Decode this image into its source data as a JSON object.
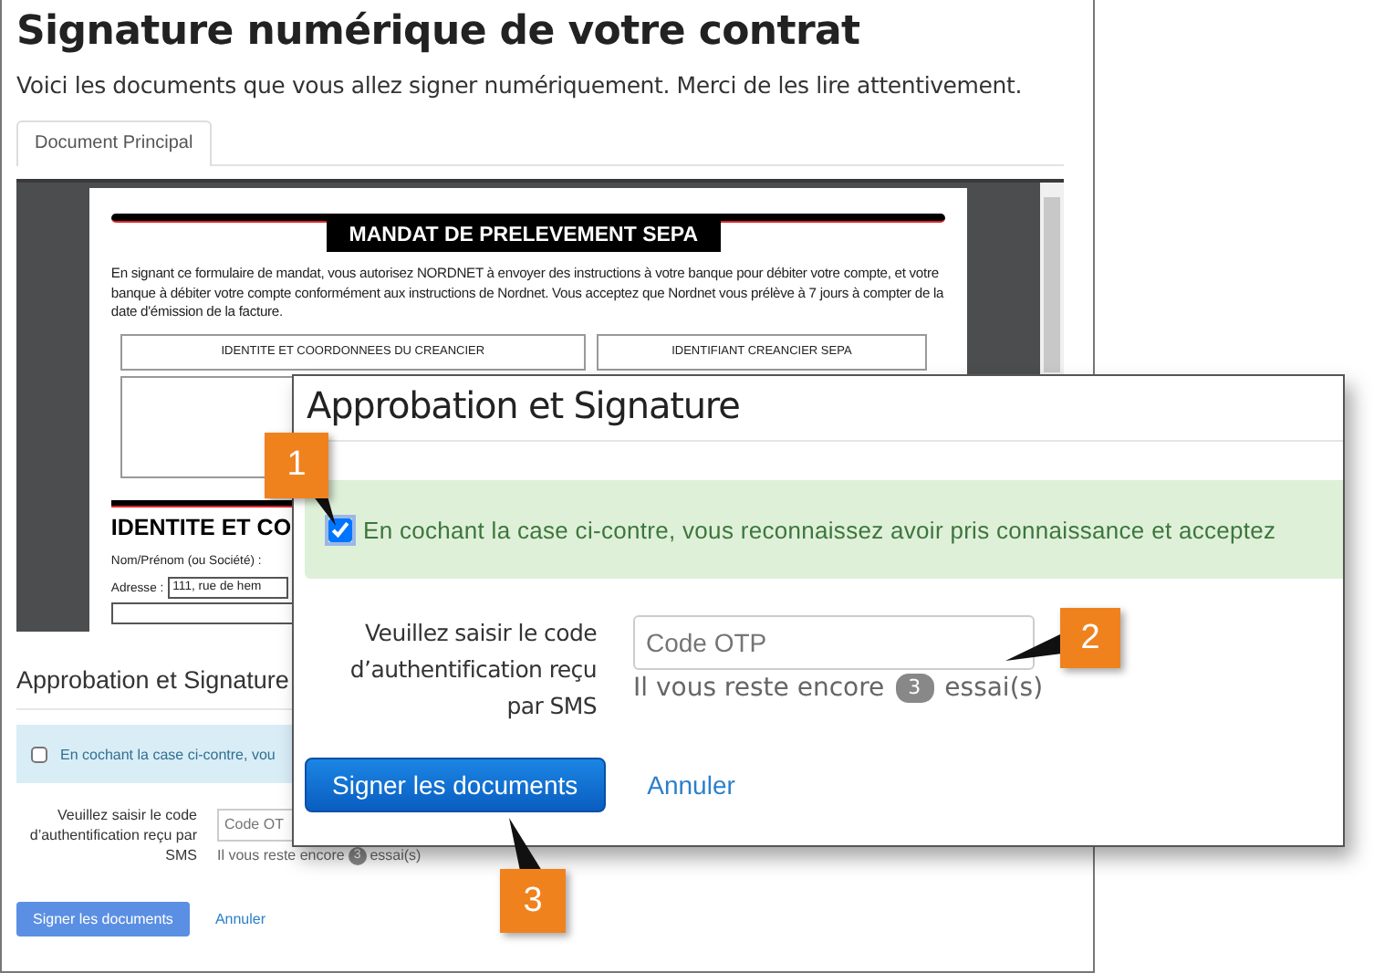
{
  "page": {
    "title": "Signature numérique de votre contrat",
    "intro": "Voici les documents que vous allez signer numériquement. Merci de les lire attentivement."
  },
  "tabs": [
    {
      "label": "Document Principal",
      "selected": true
    }
  ],
  "document": {
    "heading": "MANDAT DE PRELEVEMENT SEPA",
    "paragraph": "En signant ce formulaire de mandat, vous autorisez NORDNET à envoyer des instructions à votre banque pour débiter votre compte, et votre banque à débiter votre compte conformément aux instructions de Nordnet. Vous acceptez que Nordnet vous prélève à 7 jours à compter de la date d'émission de la facture.",
    "boxes": [
      "IDENTITE ET COORDONNEES DU CREANCIER",
      "IDENTIFIANT CREANCIER SEPA"
    ],
    "section_heading": "IDENTITE ET CO",
    "fields": [
      {
        "label": "Nom/Prénom (ou Société) :"
      },
      {
        "label": "Adresse :",
        "value": "111, rue de hem"
      }
    ]
  },
  "approval_section": {
    "title": "Approbation et Signature",
    "consent": {
      "checked": false,
      "text": "En cochant la case ci-contre, vou"
    },
    "code_label": "Veuillez saisir le code d’authentification reçu par SMS",
    "code_placeholder": "Code OT",
    "attempts_before": "Il vous reste encore",
    "attempts": "3",
    "attempts_after": "essai(s)",
    "sign_button": "Signer les documents",
    "cancel_link": "Annuler"
  },
  "dialog": {
    "title": "Approbation et Signature",
    "consent": {
      "checked": true,
      "text": "En cochant la case ci-contre, vous reconnaissez avoir pris connaissance et acceptez"
    },
    "code_label": "Veuillez saisir le code d’authentification reçu par SMS",
    "code_placeholder": "Code OTP",
    "attempts_before": "Il vous reste encore",
    "attempts": "3",
    "attempts_after": "essai(s)",
    "sign_button": "Signer les documents",
    "cancel_link": "Annuler"
  },
  "callouts": [
    {
      "label": "1"
    },
    {
      "label": "2"
    },
    {
      "label": "3"
    }
  ]
}
